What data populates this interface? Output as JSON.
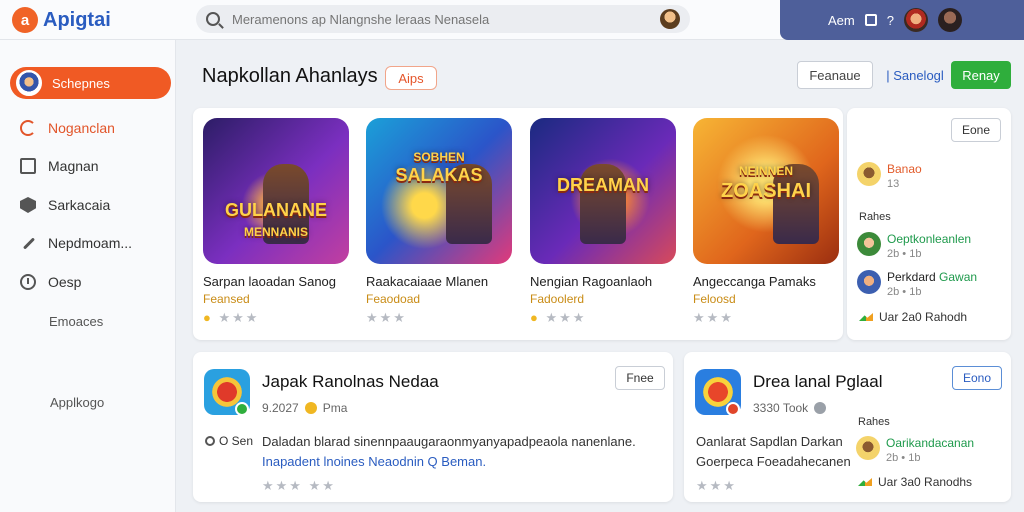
{
  "brand": {
    "logo_mark": "a",
    "name": "Apigtai"
  },
  "search": {
    "placeholder": "Meramenons ap Nlangnshe leraas Nenasela"
  },
  "topbar": {
    "item1": "Aem",
    "item3": "?"
  },
  "sidebar": {
    "active": "Schepnes",
    "items": [
      {
        "label": "Noganclan",
        "icon": "refresh-icon"
      },
      {
        "label": "Magnan",
        "icon": "box-icon"
      },
      {
        "label": "Sarkacaia",
        "icon": "shield-icon"
      },
      {
        "label": "Nepdmoam...",
        "icon": "wrench-icon"
      },
      {
        "label": "Oesp",
        "icon": "clock-icon"
      }
    ],
    "sub_label": "Emoaces",
    "footer_label": "Applkogo"
  },
  "header": {
    "title": "Napkollan Ahanlays",
    "badge": "Aips",
    "btn_outline": "Feanaue",
    "btn_link": "| Sanelogl",
    "btn_primary": "Renay"
  },
  "featured": [
    {
      "art_title": "GULANANE",
      "art_sub": "MENNANIS",
      "name": "Sarpan laoadan Sanog",
      "tag": "Feansed",
      "rating": "★★★"
    },
    {
      "art_title": "SOBHEN",
      "art_sub": "SALAKAS",
      "name": "Raakacaiaae Mlanen",
      "tag": "Feaodoad",
      "rating": "★★★"
    },
    {
      "art_title": "DREAMAN",
      "art_sub": "",
      "name": "Nengian Ragoanlaoh",
      "tag": "Fadoolerd",
      "rating": "★★★"
    },
    {
      "art_title": "NEINNEN",
      "art_sub": "ZOASHAI",
      "name": "Angeccanga Pamaks",
      "tag": "Feloosd",
      "rating": "★★★"
    }
  ],
  "right_panel": {
    "button": "Eone",
    "user1": {
      "name": "Banao",
      "sub": "13"
    },
    "section": "Rahes",
    "user2": {
      "name": "Oeptkonleanlen",
      "sub": "2b  •  1b"
    },
    "user3": {
      "name_a": "Perkdard",
      "name_b": "Gawan",
      "sub": "2b  •  1b"
    },
    "footer": "Uar 2a0 Rahodh"
  },
  "card_left": {
    "title": "Japak Ranolnas Nedaa",
    "meta": "9.2027",
    "meta2": "Pma",
    "button": "Fnee",
    "side": "O Sen",
    "desc1": "Daladan blarad sinennpaaugaraonmyanyapadpeaola nanenlane.",
    "desc2_link_a": "Inapadent lnoines",
    "desc2_link_b": "Neaodnin Q Beman.",
    "rating": "★★★ ★★"
  },
  "card_right": {
    "title": "Drea lanal Pglaal",
    "meta": "3330 Took",
    "button": "Eono",
    "desc1": "Oanlarat Sapdlan Darkan",
    "desc2": "Goerpeca Foeadahecanen",
    "section": "Rahes",
    "user": {
      "name": "Oarikandacanan",
      "sub": "2b  •  1b"
    },
    "footer": "Uar 3a0 Ranodhs",
    "rating": "★★★"
  },
  "colors": {
    "accent": "#f05a24",
    "primary": "#2a5cc0",
    "success": "#2fae3c",
    "topbar_right": "#4e5f9a"
  }
}
